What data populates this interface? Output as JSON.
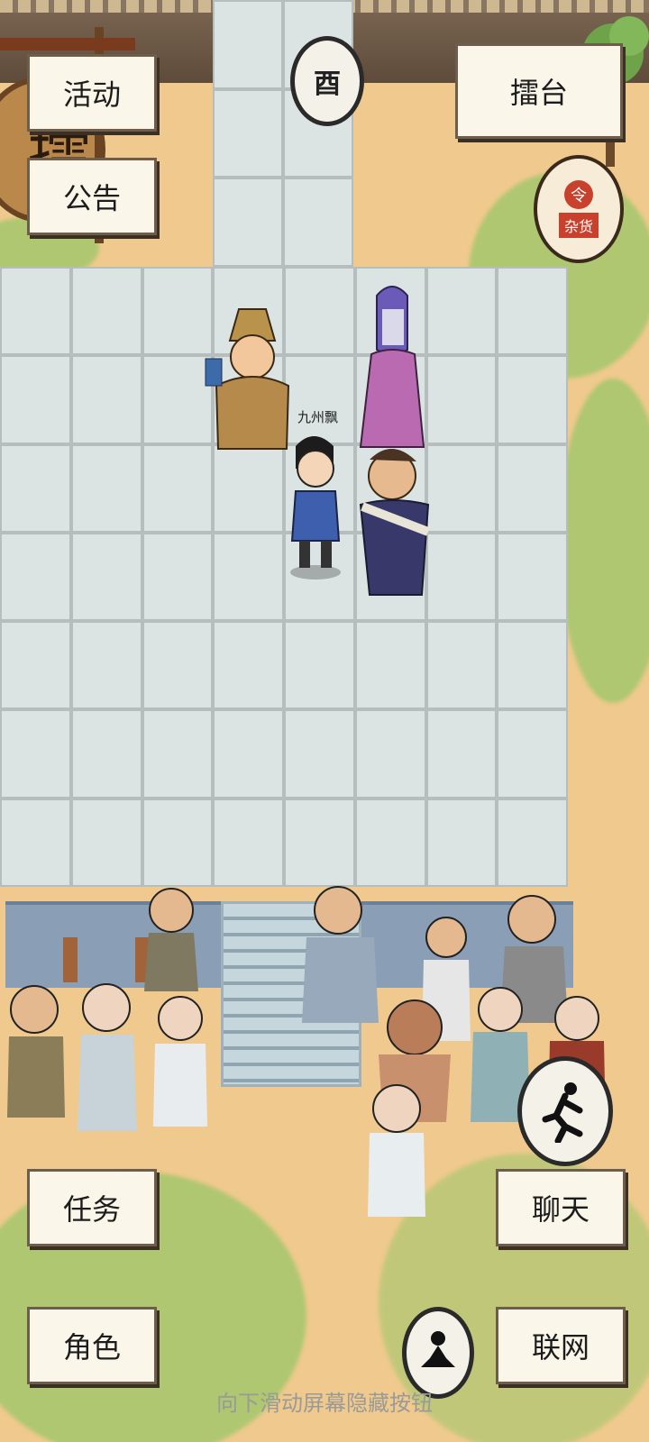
{
  "buttons": {
    "activity": "活动",
    "announcement": "公告",
    "arena": "擂台",
    "task": "任务",
    "chat": "聊天",
    "role": "角色",
    "network": "联网"
  },
  "icons": {
    "west_marker": "酉",
    "shop_label": "杂货",
    "shop_top": "令",
    "sign_glyph": "擂"
  },
  "player": {
    "name": "九州飘"
  },
  "hint": "向下滑动屏幕隐藏按钮",
  "colors": {
    "tile": "#dbe4e3",
    "grid_line": "#b6bdbd",
    "ground": "#efc98d",
    "button_bg": "#fbf6ea"
  }
}
